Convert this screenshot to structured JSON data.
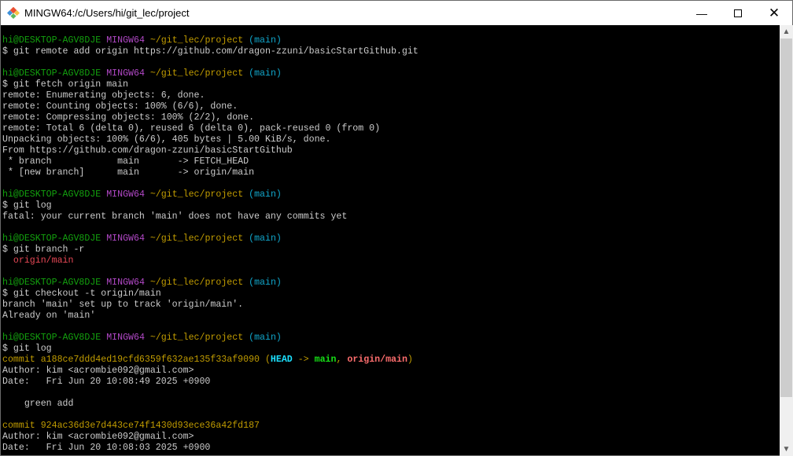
{
  "window": {
    "title": "MINGW64:/c/Users/hi/git_lec/project"
  },
  "colors": {
    "green": "#13a10e",
    "magenta": "#b148c6",
    "yellow": "#c19c00",
    "cyan": "#11a8cd",
    "text": "#cccccc",
    "red": "#e74856",
    "bright_cyan": "#1ce0ff",
    "bright_green": "#16e116",
    "bright_red": "#ff6e6e"
  },
  "terminal": {
    "lines": [
      [],
      [
        [
          "hi@DESKTOP-AGV8DJE ",
          "green"
        ],
        [
          "MINGW64 ",
          "magenta"
        ],
        [
          "~/git_lec/project",
          "yellow"
        ],
        [
          " (main)",
          "cyan"
        ]
      ],
      [
        [
          "$ git remote add origin https://github.com/dragon-zzuni/basicStartGithub.git",
          "text"
        ]
      ],
      [],
      [
        [
          "hi@DESKTOP-AGV8DJE ",
          "green"
        ],
        [
          "MINGW64 ",
          "magenta"
        ],
        [
          "~/git_lec/project",
          "yellow"
        ],
        [
          " (main)",
          "cyan"
        ]
      ],
      [
        [
          "$ git fetch origin main",
          "text"
        ]
      ],
      [
        [
          "remote: Enumerating objects: 6, done.",
          "text"
        ]
      ],
      [
        [
          "remote: Counting objects: 100% (6/6), done.",
          "text"
        ]
      ],
      [
        [
          "remote: Compressing objects: 100% (2/2), done.",
          "text"
        ]
      ],
      [
        [
          "remote: Total 6 (delta 0), reused 6 (delta 0), pack-reused 0 (from 0)",
          "text"
        ]
      ],
      [
        [
          "Unpacking objects: 100% (6/6), 405 bytes | 5.00 KiB/s, done.",
          "text"
        ]
      ],
      [
        [
          "From https://github.com/dragon-zzuni/basicStartGithub",
          "text"
        ]
      ],
      [
        [
          " * branch            main       -> FETCH_HEAD",
          "text"
        ]
      ],
      [
        [
          " * [new branch]      main       -> origin/main",
          "text"
        ]
      ],
      [],
      [
        [
          "hi@DESKTOP-AGV8DJE ",
          "green"
        ],
        [
          "MINGW64 ",
          "magenta"
        ],
        [
          "~/git_lec/project",
          "yellow"
        ],
        [
          " (main)",
          "cyan"
        ]
      ],
      [
        [
          "$ git log",
          "text"
        ]
      ],
      [
        [
          "fatal: your current branch 'main' does not have any commits yet",
          "text"
        ]
      ],
      [],
      [
        [
          "hi@DESKTOP-AGV8DJE ",
          "green"
        ],
        [
          "MINGW64 ",
          "magenta"
        ],
        [
          "~/git_lec/project",
          "yellow"
        ],
        [
          " (main)",
          "cyan"
        ]
      ],
      [
        [
          "$ git branch -r",
          "text"
        ]
      ],
      [
        [
          "  origin/main",
          "red"
        ]
      ],
      [],
      [
        [
          "hi@DESKTOP-AGV8DJE ",
          "green"
        ],
        [
          "MINGW64 ",
          "magenta"
        ],
        [
          "~/git_lec/project",
          "yellow"
        ],
        [
          " (main)",
          "cyan"
        ]
      ],
      [
        [
          "$ git checkout -t origin/main",
          "text"
        ]
      ],
      [
        [
          "branch 'main' set up to track 'origin/main'.",
          "text"
        ]
      ],
      [
        [
          "Already on 'main'",
          "text"
        ]
      ],
      [],
      [
        [
          "hi@DESKTOP-AGV8DJE ",
          "green"
        ],
        [
          "MINGW64 ",
          "magenta"
        ],
        [
          "~/git_lec/project",
          "yellow"
        ],
        [
          " (main)",
          "cyan"
        ]
      ],
      [
        [
          "$ git log",
          "text"
        ]
      ],
      [
        [
          "commit a188ce7ddd4ed19cfd6359f632ae135f33af9090 (",
          "yellow"
        ],
        [
          "HEAD",
          "bright_cyan",
          "b"
        ],
        [
          " -> ",
          "yellow"
        ],
        [
          "main",
          "bright_green",
          "b"
        ],
        [
          ", ",
          "yellow"
        ],
        [
          "origin/main",
          "bright_red",
          "b"
        ],
        [
          ")",
          "yellow"
        ]
      ],
      [
        [
          "Author: kim <acrombie092@gmail.com>",
          "text"
        ]
      ],
      [
        [
          "Date:   Fri Jun 20 10:08:49 2025 +0900",
          "text"
        ]
      ],
      [],
      [
        [
          "    green add",
          "text"
        ]
      ],
      [],
      [
        [
          "commit 924ac36d3e7d443ce74f1430d93ece36a42fd187",
          "yellow"
        ]
      ],
      [
        [
          "Author: kim <acrombie092@gmail.com>",
          "text"
        ]
      ],
      [
        [
          "Date:   Fri Jun 20 10:08:03 2025 +0900",
          "text"
        ]
      ]
    ]
  }
}
